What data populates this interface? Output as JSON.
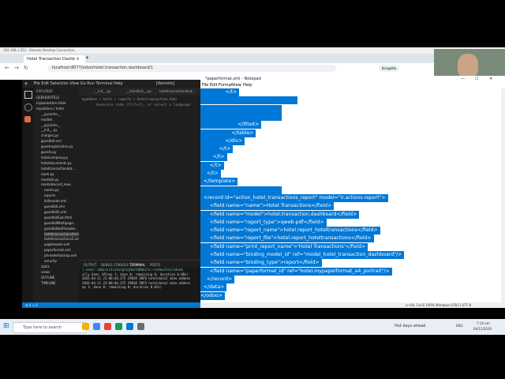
{
  "remote_title": "192.168.1.251 - Remote Desktop Connection",
  "browser": {
    "tab_title": "Hotel Transaction Dashb",
    "url": "localhost:8077/odoo/hotel.transaction.dashboard/1",
    "profile": "Incognito"
  },
  "vscode": {
    "title": "[Remote]",
    "explorer_header": "EXPLORER",
    "tree": [
      "GEEKSHOTEL2",
      "mybookstore.hotel",
      "myaddons / hotel",
      "__pycache__",
      "models",
      "__pycache__",
      "__init__.py",
      "charges.py",
      "guestbill.xml",
      "guestregistration.py",
      "guests.py",
      "hotelcompany.py",
      "hoteldocuments.py",
      "hoteltransactiondat...",
      "room.py",
      "roombill.py",
      "roomidrecord_new...",
      "rooms.py",
      "reports",
      "billheader.xml",
      "guestbill.xml",
      "guestbill2.xml",
      "guestbillSub.html",
      "guestbillMultipage...",
      "guestbillwithheader...",
      "hoteltransactionshtml",
      "hoteltransactions2.xml",
      "pageheader.xml",
      "paperformat.xml",
      "phreaderbackup.xml",
      "security",
      "static",
      "views",
      "OUTLINE",
      "TIMELINE"
    ],
    "tabs": [
      "__init__.py",
      "__manifest__.py",
      "hoteltransactiondash..."
    ],
    "breadcrumb": "myaddons > hotel > reports > hoteltransaction.html",
    "editor_line": "Generate code (Ctrl+I), or select a language",
    "terminal_tabs": [
      "OUTPUT",
      "DEBUG CONSOLE",
      "TERMINAL",
      "PORTS"
    ],
    "terminal_lines": [
      "(.venv) administrator@rajHostaMobile:~/odoo/bin/odoo$",
      "ully done (#loop 1; done 0; remaining 0; duration 0.00s)",
      "2026-04-11 23:00:04,375 29038 INFO hoteldata2 odoo.addons",
      "2026-04-11 23:00:04,375 29038 INFO hoteldata2 odoo.addons",
      "op 1; done 0; remaining 0; duration 0.02s)"
    ],
    "status": "⊗ 0 ⚠ 0"
  },
  "notepad": {
    "title": "*paperformat.xml - Notepad",
    "menu": [
      "File",
      "Edit",
      "Format",
      "View",
      "Help"
    ],
    "lines": [
      "                </t>",
      "",
      "",
      "",
      "                        </tfoot>",
      "                    </table>",
      "                </div>",
      "            </t>",
      "        </t>",
      "      </t>",
      "    </t>",
      "  </template>",
      "",
      "  <record id=\"action_hotel_transactions_report\" model=\"ir.actions.report\">",
      "      <field name=\"name\">Hotel Transactions</field>",
      "      <field name=\"model\">hotel.transaction.dashboard</field>",
      "      <field name=\"report_type\">qweb-pdf</field>",
      "      <field name=\"report_name\">hotel.report_hoteltransactions</field>",
      "      <field name=\"report_file\">hotel.report_hoteltransactions</field>",
      "      <field name=\"print_report_name\">'Hotel Transactions'</field>",
      "      <field name=\"binding_model_id\" ref=\"model_hotel_transaction_dashboard\"/>",
      "      <field name=\"binding_type\">report</field>",
      "      <field name=\"paperformat_id\" ref=\"hotel.mypaperformat_a4_portrait\"/>",
      "    </record>",
      "  </data>",
      "</odoo>"
    ],
    "status": "Ln 66, Col 8    100%   Windows (CRLF)   UTF-8"
  },
  "taskbar": {
    "search_placeholder": "Type here to search",
    "weather": "Hot days ahead",
    "time": "7:16 am",
    "date": "04/12/2026",
    "lang": "ENG"
  },
  "colors": {
    "selection": "#0078d7",
    "vscode_status": "#007acc"
  }
}
